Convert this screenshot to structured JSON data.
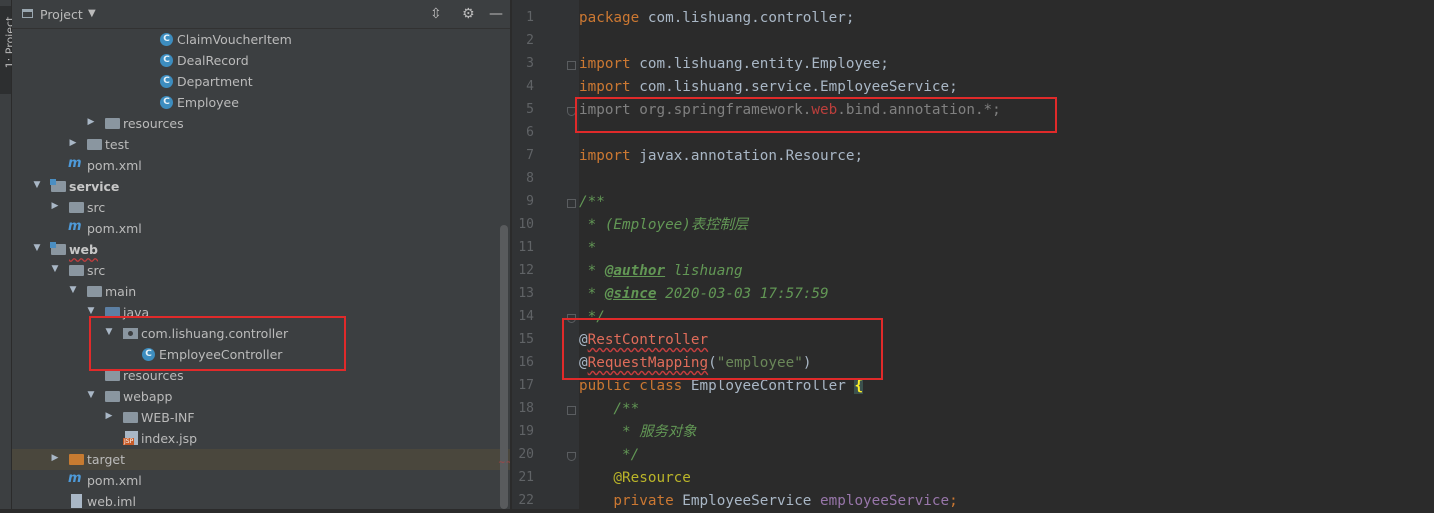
{
  "strip": {
    "tab_label": "1: Project"
  },
  "panel": {
    "title": "Project",
    "header_buttons": [
      "collapse-all-icon",
      "gear-icon",
      "hide-icon"
    ]
  },
  "tree": [
    {
      "label": "ClaimVoucherItem",
      "type": "class"
    },
    {
      "label": "DealRecord",
      "type": "class"
    },
    {
      "label": "Department",
      "type": "class"
    },
    {
      "label": "Employee",
      "type": "class"
    },
    {
      "label": "resources",
      "type": "folder",
      "state": "collapsed"
    },
    {
      "label": "test",
      "type": "folder",
      "state": "collapsed"
    },
    {
      "label": "pom.xml",
      "type": "maven"
    },
    {
      "label": "service",
      "type": "module",
      "state": "expanded"
    },
    {
      "label": "src",
      "type": "folder",
      "state": "collapsed"
    },
    {
      "label": "pom.xml",
      "type": "maven"
    },
    {
      "label": "web",
      "type": "module",
      "state": "expanded"
    },
    {
      "label": "src",
      "type": "folder",
      "state": "expanded"
    },
    {
      "label": "main",
      "type": "folder",
      "state": "expanded"
    },
    {
      "label": "java",
      "type": "folder",
      "state": "expanded"
    },
    {
      "label": "com.lishuang.controller",
      "type": "package",
      "state": "expanded"
    },
    {
      "label": "EmployeeController",
      "type": "class"
    },
    {
      "label": "resources",
      "type": "folder"
    },
    {
      "label": "webapp",
      "type": "folder",
      "state": "expanded"
    },
    {
      "label": "WEB-INF",
      "type": "folder",
      "state": "collapsed"
    },
    {
      "label": "index.jsp",
      "type": "jsp"
    },
    {
      "label": "target",
      "type": "folder",
      "state": "collapsed",
      "selected": true
    },
    {
      "label": "pom.xml",
      "type": "maven"
    },
    {
      "label": "web.iml",
      "type": "iml"
    }
  ],
  "editor": {
    "line_numbers": [
      "1",
      "2",
      "3",
      "4",
      "5",
      "6",
      "7",
      "8",
      "9",
      "10",
      "11",
      "12",
      "13",
      "14",
      "15",
      "16",
      "17",
      "18",
      "19",
      "20",
      "21",
      "22"
    ],
    "code": {
      "l1_kw": "package",
      "l1_rest": " com.lishuang.controller;",
      "l3_kw": "import",
      "l3_rest": " com.lishuang.entity.Employee;",
      "l4_kw": "import",
      "l4_rest": " com.lishuang.service.EmployeeService;",
      "l5_a": "import org.springframework.",
      "l5_web": "web",
      "l5_b": ".bind.annotation.*;",
      "l7_kw": "import",
      "l7_rest": " javax.annotation.Resource;",
      "l9": "/**",
      "l10": " * (Employee)表控制层",
      "l11": " *",
      "l12_a": " * ",
      "l12_tag": "@author",
      "l12_b": " lishuang",
      "l13_a": " * ",
      "l13_tag": "@since",
      "l13_b": " 2020-03-03 17:57:59",
      "l14": " */",
      "l15_at": "@",
      "l15_name": "RestController",
      "l16_at": "@",
      "l16_name": "RequestMapping",
      "l16_open": "(",
      "l16_str": "\"employee\"",
      "l16_close": ")",
      "l17_kw": "public class",
      "l17_rest": " EmployeeController ",
      "l17_brace": "{",
      "l18": "    /**",
      "l19": "     * 服务对象",
      "l20": "     */",
      "l21": "    @Resource",
      "l22_kw": "    private",
      "l22_rest": " EmployeeService ",
      "l22_fld": "employeeService",
      "l22_end": ";"
    }
  }
}
